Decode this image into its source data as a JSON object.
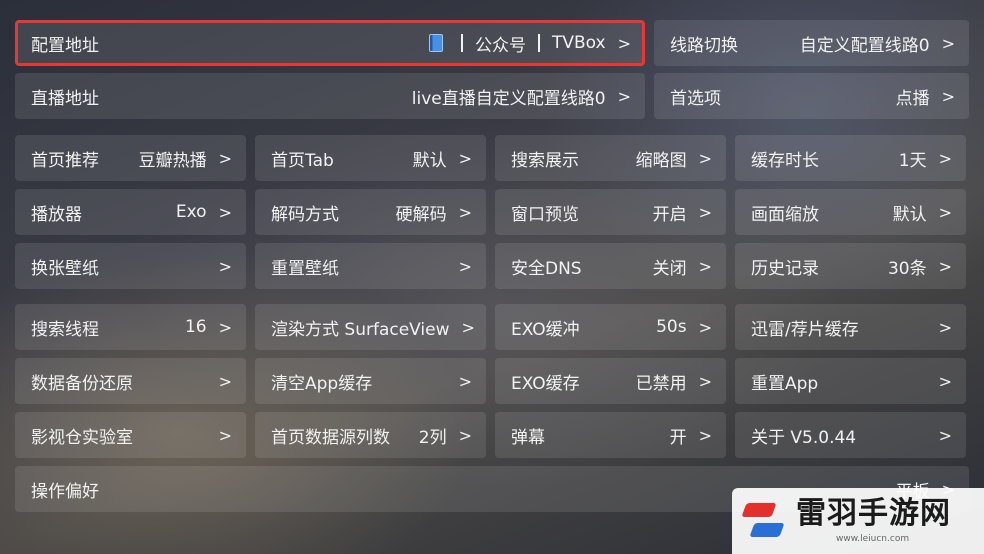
{
  "rows": [
    [
      {
        "name": "config-address",
        "label": "配置地址",
        "value_parts": [
          "公众号",
          "TVBox"
        ],
        "has_icon": true,
        "selected": true
      },
      {
        "name": "line-switch",
        "label": "线路切换",
        "value": "自定义配置线路0"
      }
    ],
    [
      {
        "name": "live-address",
        "label": "直播地址",
        "value": "live直播自定义配置线路0"
      },
      {
        "name": "preferences",
        "label": "首选项",
        "value": "点播"
      }
    ],
    [
      {
        "name": "home-recommend",
        "label": "首页推荐",
        "value": "豆瓣热播"
      },
      {
        "name": "home-tab",
        "label": "首页Tab",
        "value": "默认"
      },
      {
        "name": "search-display",
        "label": "搜索展示",
        "value": "缩略图"
      },
      {
        "name": "cache-duration",
        "label": "缓存时长",
        "value": "1天"
      }
    ],
    [
      {
        "name": "player",
        "label": "播放器",
        "value": "Exo"
      },
      {
        "name": "decode-mode",
        "label": "解码方式",
        "value": "硬解码"
      },
      {
        "name": "window-preview",
        "label": "窗口预览",
        "value": "开启"
      },
      {
        "name": "screen-scale",
        "label": "画面缩放",
        "value": "默认"
      }
    ],
    [
      {
        "name": "change-wallpaper",
        "label": "换张壁纸",
        "value": ""
      },
      {
        "name": "reset-wallpaper",
        "label": "重置壁纸",
        "value": ""
      },
      {
        "name": "secure-dns",
        "label": "安全DNS",
        "value": "关闭"
      },
      {
        "name": "history",
        "label": "历史记录",
        "value": "30条"
      }
    ],
    [
      {
        "name": "search-threads",
        "label": "搜索线程",
        "value": "16"
      },
      {
        "name": "render-mode",
        "label": "渲染方式 SurfaceView",
        "value": ""
      },
      {
        "name": "exo-buffer",
        "label": "EXO缓冲",
        "value": "50s"
      },
      {
        "name": "thunder-cache",
        "label": "迅雷/荐片缓存",
        "value": ""
      }
    ],
    [
      {
        "name": "data-backup",
        "label": "数据备份还原",
        "value": ""
      },
      {
        "name": "clear-app-cache",
        "label": "清空App缓存",
        "value": ""
      },
      {
        "name": "exo-cache",
        "label": "EXO缓存",
        "value": "已禁用"
      },
      {
        "name": "reset-app",
        "label": "重置App",
        "value": ""
      }
    ],
    [
      {
        "name": "lab",
        "label": "影视仓实验室",
        "value": ""
      },
      {
        "name": "home-columns",
        "label": "首页数据源列数",
        "value": "2列"
      },
      {
        "name": "danmaku",
        "label": "弹幕",
        "value": "开"
      },
      {
        "name": "about",
        "label": "关于  V5.0.44",
        "value": ""
      }
    ],
    [
      {
        "name": "operation-pref",
        "label": "操作偏好",
        "value": "平板"
      }
    ]
  ],
  "arrow": ">",
  "watermark": {
    "title": "雷羽手游网",
    "url": "www.leiucn.com"
  }
}
